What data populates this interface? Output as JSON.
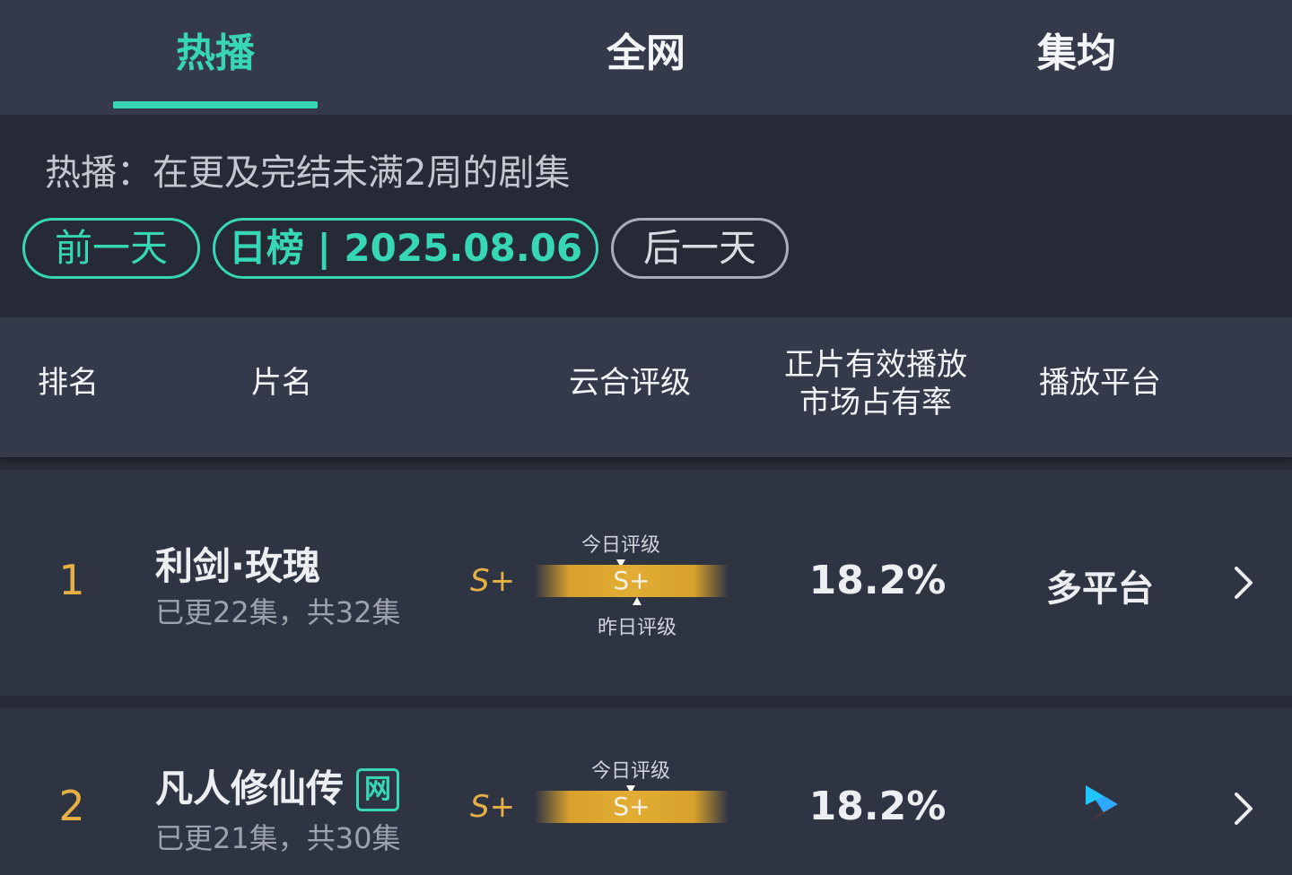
{
  "tabs": [
    {
      "label": "热播",
      "active": true
    },
    {
      "label": "全网",
      "active": false
    },
    {
      "label": "集均",
      "active": false
    }
  ],
  "info": {
    "description": "热播：在更及完结未满2周的剧集",
    "prev_label": "前一天",
    "date_label": "日榜 | 2025.08.06",
    "next_label": "后一天"
  },
  "table_header": {
    "rank": "排名",
    "title": "片名",
    "rating": "云合评级",
    "share_line1": "正片有效播放",
    "share_line2": "市场占有率",
    "platform": "播放平台"
  },
  "rows": [
    {
      "rank": "1",
      "title": "利剑·玫瑰",
      "episodes": "已更22集，共32集",
      "grade": "S+",
      "bar_grade": "S+",
      "today_label": "今日评级",
      "yesterday_label": "昨日评级",
      "share": "18.2%",
      "platform": "多平台",
      "badge": ""
    },
    {
      "rank": "2",
      "title": "凡人修仙传",
      "episodes": "已更21集，共30集",
      "grade": "S+",
      "bar_grade": "S+",
      "today_label": "今日评级",
      "share": "18.2%",
      "platform_icon": "youku-play-icon",
      "badge": "网"
    }
  ],
  "colors": {
    "accent": "#37d6b4",
    "gold": "#e6b045",
    "header_bg": "#353a4a",
    "page_bg": "#262a36",
    "row_bg": "#2f3443"
  }
}
